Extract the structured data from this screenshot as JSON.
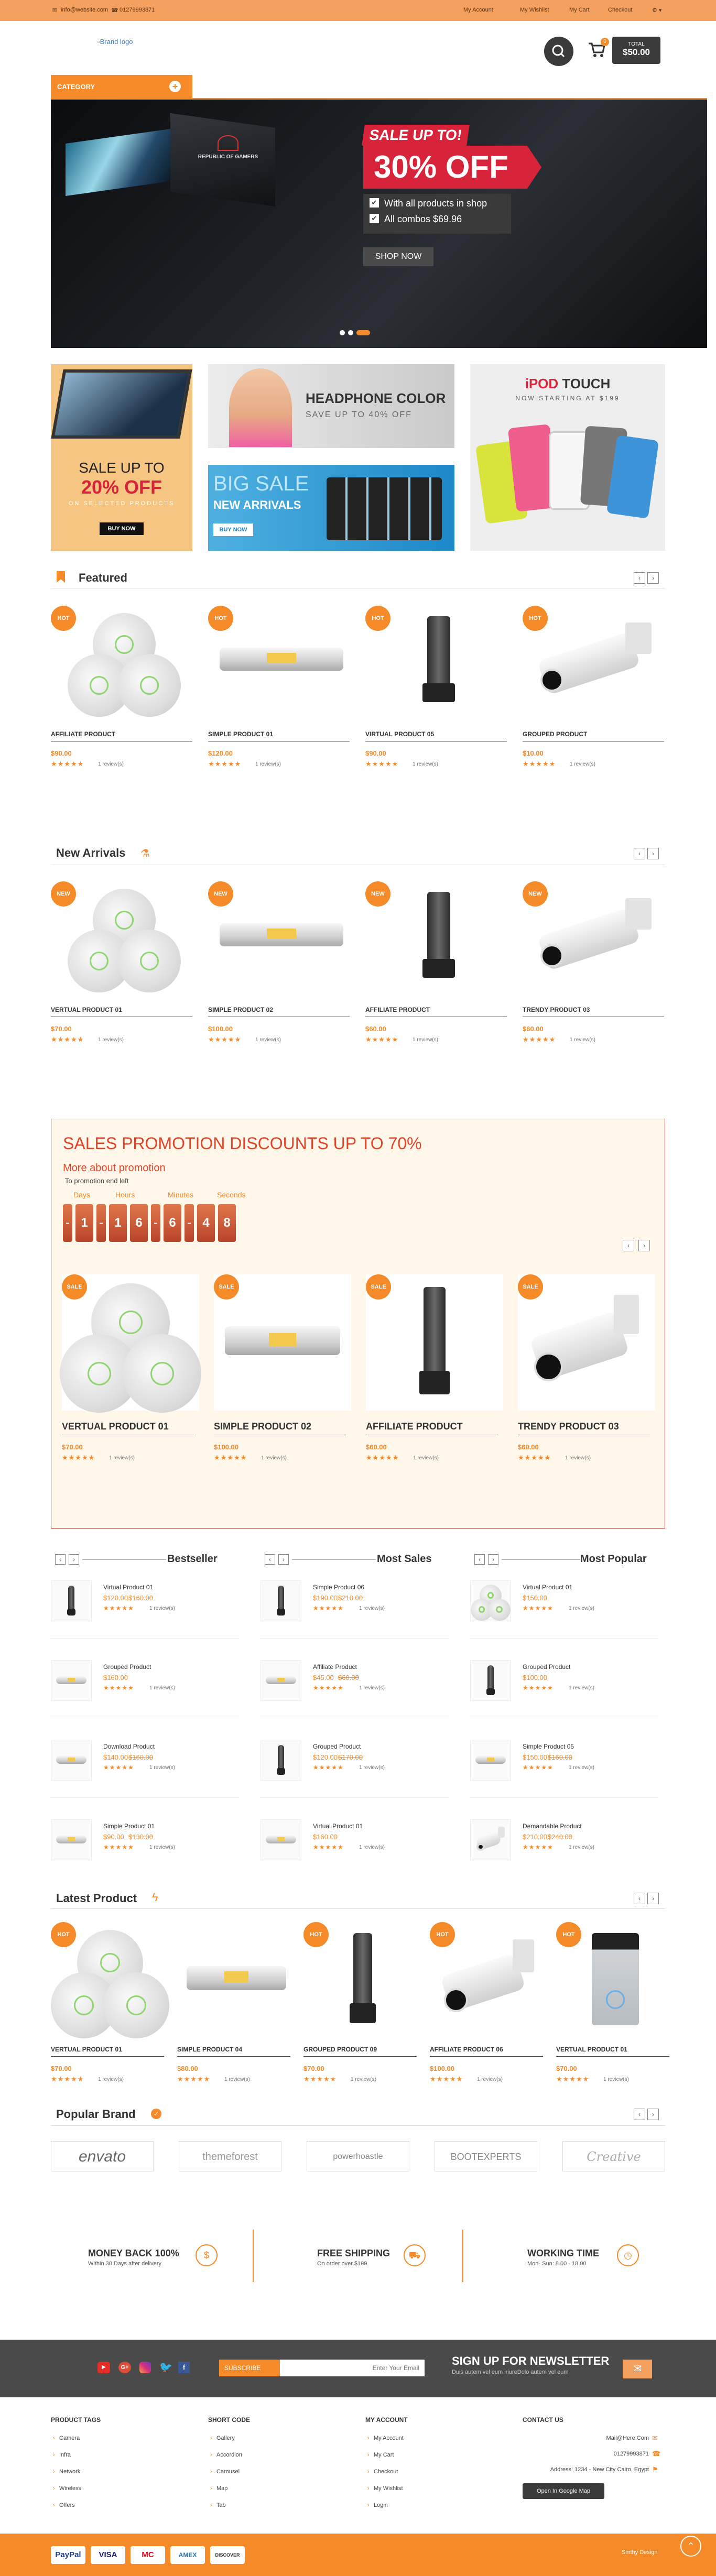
{
  "topbar": {
    "email": "info@website.com",
    "phone": "01279993871",
    "links": [
      "My Account",
      "My Wishlist",
      "My Cart",
      "Checkout"
    ]
  },
  "header": {
    "logo_alt": "Brand logo",
    "cart_count": "0",
    "total_label": "TOTAL",
    "total_value": "$50.00"
  },
  "category_label": "CATEGORY",
  "hero": {
    "sale_title": "SALE UP TO!",
    "discount": "30% OFF",
    "features": [
      "With all products in shop",
      "All combos $69.96"
    ],
    "button": "SHOP NOW",
    "brand_mark": "REPUBLIC OF GAMERS"
  },
  "banners": {
    "b1_line1": "SALE UP TO",
    "b1_line2": "20% OFF",
    "b1_sub": "ON SELECTED PRODUCTS",
    "b1_btn": "BUY NOW",
    "b2_title": "HEADPHONE COLOR",
    "b2_sub": "SAVE UP TO 40% OFF",
    "b3_title": "BIG SALE",
    "b3_sub": "NEW ARRIVALS",
    "b3_btn": "BUY NOW",
    "b4_title_a": "iPOD",
    "b4_title_b": "TOUCH",
    "b4_sub": "NOW STARTING AT $199"
  },
  "featured": {
    "title": "Featured",
    "items": [
      {
        "badge": "HOT",
        "name": "AFFILIATE PRODUCT",
        "price": "$90.00",
        "reviews": "1 review(s)"
      },
      {
        "badge": "HOT",
        "name": "SIMPLE PRODUCT 01",
        "price": "$120.00",
        "reviews": "1 review(s)"
      },
      {
        "badge": "HOT",
        "name": "VIRTUAL PRODUCT 05",
        "price": "$90.00",
        "reviews": "1 review(s)"
      },
      {
        "badge": "HOT",
        "name": "GROUPED PRODUCT",
        "price": "$10.00",
        "reviews": "1 review(s)"
      }
    ]
  },
  "new_arrivals": {
    "title": "New Arrivals",
    "items": [
      {
        "badge": "NEW",
        "name": "VERTUAL PRODUCT 01",
        "price": "$70.00",
        "reviews": "1 review(s)"
      },
      {
        "badge": "NEW",
        "name": "SIMPLE PRODUCT 02",
        "price": "$100.00",
        "reviews": "1 review(s)"
      },
      {
        "badge": "NEW",
        "name": "AFFILIATE PRODUCT",
        "price": "$60.00",
        "reviews": "1 review(s)"
      },
      {
        "badge": "NEW",
        "name": "TRENDY PRODUCT 03",
        "price": "$60.00",
        "reviews": "1 review(s)"
      }
    ]
  },
  "promo": {
    "title": "SALES PROMOTION DISCOUNTS UP TO 70%",
    "more": "More about promotion",
    "ends": "To promotion end left",
    "labels": [
      "Days",
      "Hours",
      "Minutes",
      "Seconds"
    ],
    "digits": [
      "-",
      "1",
      "-",
      "1",
      "6",
      "-",
      "6",
      "-",
      "4",
      "8"
    ],
    "items": [
      {
        "badge": "SALE",
        "name": "VERTUAL PRODUCT 01",
        "price": "$70.00",
        "reviews": "1 review(s)"
      },
      {
        "badge": "SALE",
        "name": "SIMPLE PRODUCT 02",
        "price": "$100.00",
        "reviews": "1 review(s)"
      },
      {
        "badge": "SALE",
        "name": "AFFILIATE PRODUCT",
        "price": "$60.00",
        "reviews": "1 review(s)"
      },
      {
        "badge": "SALE",
        "name": "TRENDY PRODUCT 03",
        "price": "$60.00",
        "reviews": "1 review(s)"
      }
    ]
  },
  "lists": {
    "titles": [
      "Bestseller",
      "Most Sales",
      "Most Popular"
    ],
    "col1": [
      {
        "name": "Virtual Product 01",
        "price": "$120.00",
        "old": "$160.00",
        "reviews": "1 review(s)"
      },
      {
        "name": "Grouped Product",
        "price": "$160.00",
        "old": "",
        "reviews": "1 review(s)"
      },
      {
        "name": "Download Product",
        "price": "$140.00",
        "old": "$160.00",
        "reviews": "1 review(s)"
      },
      {
        "name": "Simple Product 01",
        "price": "$90.00",
        "old": "$130.00",
        "reviews": "1 review(s)"
      }
    ],
    "col2": [
      {
        "name": "Simple Product 06",
        "price": "$190.00",
        "old": "$210.00",
        "reviews": "1 review(s)"
      },
      {
        "name": "Affiliate Product",
        "price": "$45.00",
        "old": "$60.00",
        "reviews": "1 review(s)"
      },
      {
        "name": "Grouped Product",
        "price": "$120.00",
        "old": "$170.00",
        "reviews": "1 review(s)"
      },
      {
        "name": "Virtual Product 01",
        "price": "$160.00",
        "old": "",
        "reviews": "1 review(s)"
      }
    ],
    "col3": [
      {
        "name": "Virtual Product 01",
        "price": "$150.00",
        "old": "",
        "reviews": "1 review(s)"
      },
      {
        "name": "Grouped Product",
        "price": "$100.00",
        "old": "",
        "reviews": "1 review(s)"
      },
      {
        "name": "Simple Product 05",
        "price": "$150.00",
        "old": "$160.00",
        "reviews": "1 review(s)"
      },
      {
        "name": "Demandable Product",
        "price": "$210.00",
        "old": "$240.00",
        "reviews": "1 review(s)"
      }
    ]
  },
  "latest": {
    "title": "Latest Product",
    "items": [
      {
        "badge": "HOT",
        "name": "VERTUAL PRODUCT 01",
        "price": "$70.00",
        "reviews": "1 review(s)"
      },
      {
        "badge": "",
        "name": "SIMPLE PRODUCT 04",
        "price": "$80.00",
        "reviews": "1 review(s)"
      },
      {
        "badge": "HOT",
        "name": "GROUPED PRODUCT 09",
        "price": "$70.00",
        "reviews": "1 review(s)"
      },
      {
        "badge": "HOT",
        "name": "AFFILIATE PRODUCT 06",
        "price": "$100.00",
        "reviews": "1 review(s)"
      },
      {
        "badge": "HOT",
        "name": "VERTUAL PRODUCT 01",
        "price": "$70.00",
        "reviews": "1 review(s)"
      }
    ]
  },
  "brands": {
    "title": "Popular Brand",
    "items": [
      "envato",
      "themeforest",
      "powerhoastle",
      "BOOTEXPERTS",
      "Creative"
    ]
  },
  "services": [
    {
      "title": "MONEY BACK 100%",
      "sub": "Within 30 Days after delivery",
      "icon": "$"
    },
    {
      "title": "FREE SHIPPING",
      "sub": "On order over $199",
      "icon": "truck"
    },
    {
      "title": "WORKING TIME",
      "sub": "Mon- Sun: 8.00 - 18.00",
      "icon": "clock"
    }
  ],
  "newsletter": {
    "subscribe": "SUBSCRIBE",
    "placeholder": "Enter Your Email",
    "title": "SIGN UP FOR NEWSLETTER",
    "sub": "Duis autem vel eum iriureDolo autem vel eum"
  },
  "footer": {
    "product_tags": {
      "title": "PRODUCT TAGS",
      "items": [
        "Camera",
        "Infra",
        "Network",
        "Wireless",
        "Offers"
      ]
    },
    "short_code": {
      "title": "SHORT CODE",
      "items": [
        "Gallery",
        "Accordion",
        "Carousel",
        "Map",
        "Tab"
      ]
    },
    "my_account": {
      "title": "MY ACCOUNT",
      "items": [
        "My Account",
        "My Cart",
        "Checkout",
        "My Wishlist",
        "Login"
      ]
    },
    "contact": {
      "title": "CONTACT US",
      "email": "Mail@Here.Com",
      "phone": "01279993871",
      "address": "Address: 1234 - New City Cairo, Egypt",
      "map_btn": "Open In Google Map"
    }
  },
  "payments": [
    "PayPal",
    "VISA",
    "MC",
    "AMEX",
    "DISCOVER"
  ],
  "credit": "Smthy Design"
}
